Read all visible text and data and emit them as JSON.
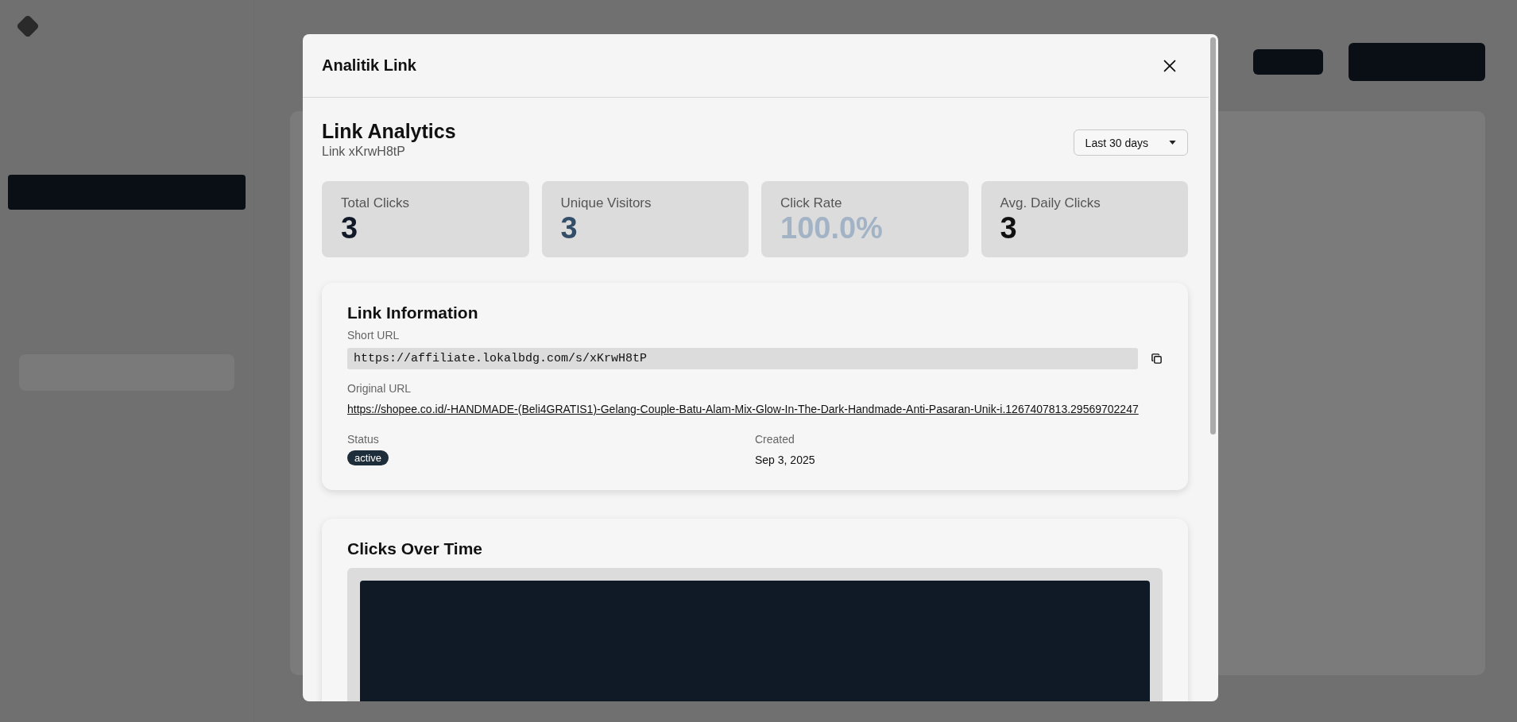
{
  "modal": {
    "title": "Analitik Link"
  },
  "header": {
    "title": "Link Analytics",
    "subtitle": "Link xKrwH8tP",
    "range": "Last 30 days"
  },
  "stats": [
    {
      "label": "Total Clicks",
      "value": "3",
      "color": "#111827"
    },
    {
      "label": "Unique Visitors",
      "value": "3",
      "color": "#334e68"
    },
    {
      "label": "Click Rate",
      "value": "100.0%",
      "color": "#a3b3c6"
    },
    {
      "label": "Avg. Daily Clicks",
      "value": "3",
      "color": "#111111"
    }
  ],
  "link_info": {
    "title": "Link Information",
    "short_url_label": "Short URL",
    "short_url": "https://affiliate.lokalbdg.com/s/xKrwH8tP",
    "original_url_label": "Original URL",
    "original_url": "https://shopee.co.id/-HANDMADE-(Beli4GRATIS1)-Gelang-Couple-Batu-Alam-Mix-Glow-In-The-Dark-Handmade-Anti-Pasaran-Unik-i.1267407813.29569702247",
    "status_label": "Status",
    "status": "active",
    "created_label": "Created",
    "created": "Sep 3, 2025"
  },
  "clicks_chart": {
    "title": "Clicks Over Time"
  }
}
